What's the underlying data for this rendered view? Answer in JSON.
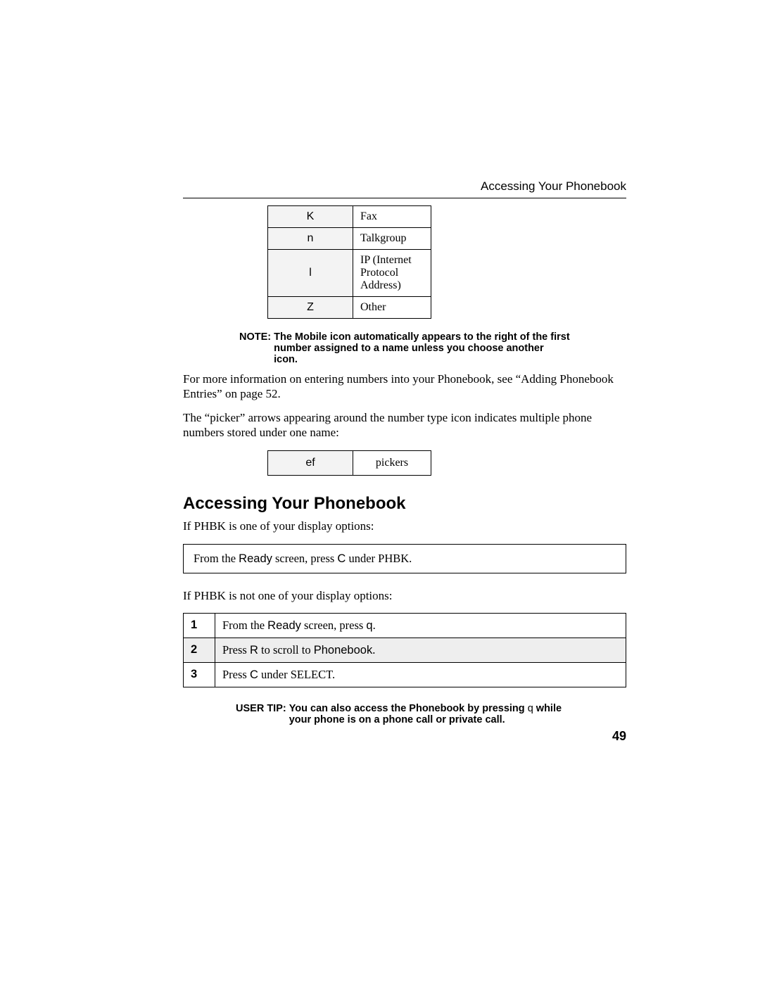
{
  "running_head": "Accessing Your Phonebook",
  "icon_rows": [
    {
      "icon": "K",
      "desc": "Fax"
    },
    {
      "icon": "n",
      "desc": "Talkgroup"
    },
    {
      "icon": "l",
      "desc": "IP (Internet Protocol Address)"
    },
    {
      "icon": "Z",
      "desc": "Other"
    }
  ],
  "note": {
    "label": "NOTE:",
    "body": "The Mobile icon automatically appears to the right of the first number assigned to a name unless you choose another icon."
  },
  "para_more_info": "For more information on entering numbers into your Phonebook, see “Adding Phonebook Entries” on page 52.",
  "para_picker": "The “picker” arrows appearing around the number type icon indicates multiple phone numbers stored under one name:",
  "picker_row": {
    "left": "ef",
    "right": "pickers"
  },
  "section_heading": "Accessing Your Phonebook",
  "intro1": "If PHBK is one of your display options:",
  "single_step": {
    "pre": "From the ",
    "ready": "Ready",
    "mid": " screen, press ",
    "key": "C",
    "post": " under PHBK."
  },
  "intro2": "If PHBK is not one of your display options:",
  "steps": [
    {
      "n": "1",
      "pre": "From the ",
      "ready": "Ready",
      "mid": " screen, press ",
      "key": "q",
      "post": "."
    },
    {
      "n": "2",
      "pre": "Press ",
      "key": "R",
      "mid2": " to scroll to ",
      "target": "Phonebook",
      "post": "."
    },
    {
      "n": "3",
      "pre": "Press ",
      "key": "C",
      "post": " under SELECT."
    }
  ],
  "tip": {
    "label": "USER TIP:",
    "body_a": "You can also access the Phonebook by pressing ",
    "key": "q",
    "body_b": " while your phone is on a phone call or private call."
  },
  "page_number": "49"
}
